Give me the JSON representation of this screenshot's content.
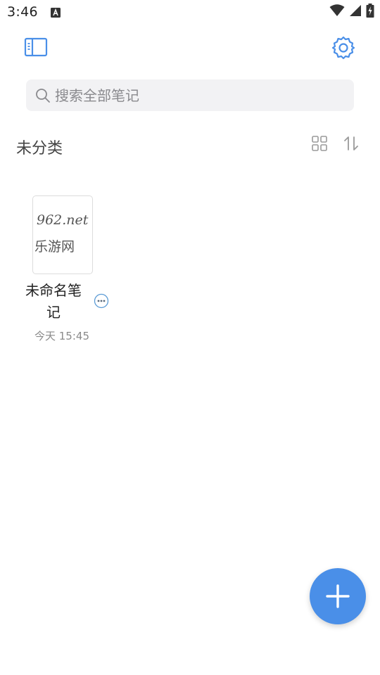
{
  "status_bar": {
    "time": "3:46",
    "notification_icon": "a-icon",
    "icons": [
      "wifi-icon",
      "signal-icon",
      "battery-charging-icon"
    ]
  },
  "toolbar": {
    "sidebar_icon": "sidebar-icon",
    "settings_icon": "gear-icon"
  },
  "search": {
    "placeholder": "搜索全部笔记",
    "value": ""
  },
  "section": {
    "title": "未分类",
    "view_icon": "grid-icon",
    "sort_icon": "sort-icon"
  },
  "notes": [
    {
      "title": "未命名笔记",
      "timestamp": "今天 15:45",
      "thumbnail_text_line1": "962.net",
      "thumbnail_text_line2": "乐游网"
    }
  ],
  "fab": {
    "icon": "plus-icon"
  },
  "colors": {
    "accent": "#4a8fe8",
    "search_bg": "#f2f2f4",
    "icon_gray": "#9a9a9a"
  }
}
